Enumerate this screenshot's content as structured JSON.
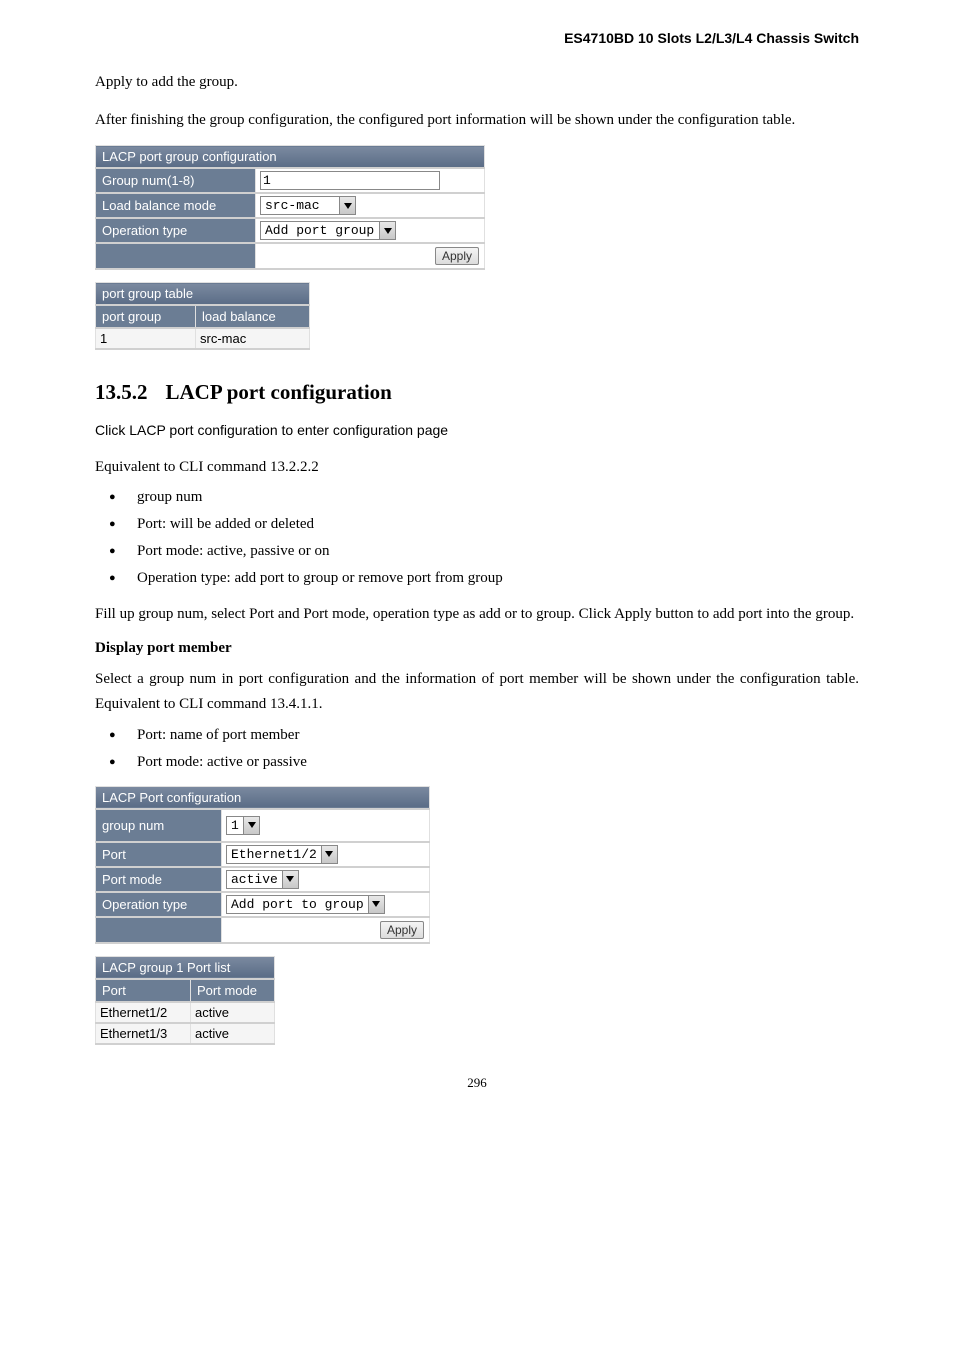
{
  "header": {
    "title": "ES4710BD 10 Slots L2/L3/L4 Chassis Switch"
  },
  "body": {
    "p1": "Apply to add the group.",
    "p2": "After finishing the group configuration, the configured port information will be shown under the configuration table."
  },
  "cfg1": {
    "title": "LACP port group configuration",
    "row1_label": "Group num(1-8)",
    "row1_value": "1",
    "row2_label": "Load balance mode",
    "row2_value": "src-mac",
    "row3_label": "Operation type",
    "row3_value": "Add port group",
    "apply": "Apply"
  },
  "res1": {
    "title": "port group table",
    "h1": "port group",
    "h2": "load balance",
    "c1": "1",
    "c2": "src-mac"
  },
  "sec": {
    "num": "13.5.2",
    "title": "LACP port configuration",
    "click": "Click LACP port configuration to enter configuration page",
    "equiv": "Equivalent to CLI command 13.2.2.2",
    "b1": "group num",
    "b2": "Port: will be added or deleted",
    "b3": "Port mode: active, passive or on",
    "b4": "Operation type: add port to group or remove port from group",
    "fill": "Fill up group num, select Port and Port mode, operation type as add or to group. Click Apply button to add port into the group.",
    "disp": "Display port member",
    "sel_p": "Select a group num in port configuration and the information of port member will be shown under the configuration table. Equivalent to CLI command 13.4.1.1.",
    "b5": "Port: name of port member",
    "b6": "Port mode: active or passive"
  },
  "cfg2": {
    "title": "LACP Port configuration",
    "row1_label": "group num",
    "row1_value": "1",
    "row2_label": "Port",
    "row2_value": "Ethernet1/2",
    "row3_label": "Port mode",
    "row3_value": "active",
    "row4_label": "Operation type",
    "row4_value": "Add port to group",
    "apply": "Apply"
  },
  "res2": {
    "title": "LACP group 1 Port list",
    "h1": "Port",
    "h2": "Port mode",
    "r1c1": "Ethernet1/2",
    "r1c2": "active",
    "r2c1": "Ethernet1/3",
    "r2c2": "active"
  },
  "footer": {
    "page": "296"
  },
  "chart_data": []
}
